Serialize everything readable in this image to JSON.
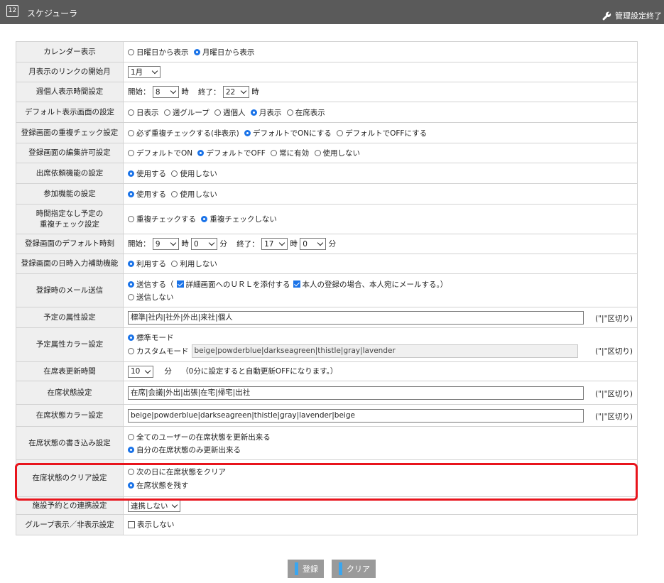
{
  "header": {
    "calendar_icon_number": "12",
    "title": "スケジューラ",
    "exit_label": "管理設定終了"
  },
  "rows": {
    "calendar": {
      "label": "カレンダー表示",
      "opt1": "日曜日から表示",
      "opt2": "月曜日から表示"
    },
    "month_link": {
      "label": "月表示のリンクの開始月",
      "value": "1月"
    },
    "week_personal_time": {
      "label": "週個人表示時間設定",
      "start_label": "開始：",
      "start_value": "8",
      "hour1": "時",
      "end_label": "終了：",
      "end_value": "22",
      "hour2": "時"
    },
    "default_screen": {
      "label": "デフォルト表示画面の設定",
      "opts": [
        "日表示",
        "週グループ",
        "週個人",
        "月表示",
        "在席表示"
      ]
    },
    "dup_check": {
      "label": "登録画面の重複チェック設定",
      "opts": [
        "必ず重複チェックする(非表示)",
        "デフォルトでONにする",
        "デフォルトでOFFにする"
      ]
    },
    "edit_permission": {
      "label": "登録画面の編集許可設定",
      "opts": [
        "デフォルトでON",
        "デフォルトでOFF",
        "常に有効",
        "使用しない"
      ]
    },
    "attendance_request": {
      "label": "出席依頼機能の設定",
      "opts": [
        "使用する",
        "使用しない"
      ]
    },
    "participation": {
      "label": "参加機能の設定",
      "opts": [
        "使用する",
        "使用しない"
      ]
    },
    "no_time_dup": {
      "label_line1": "時間指定なし予定の",
      "label_line2": "重複チェック設定",
      "opts": [
        "重複チェックする",
        "重複チェックしない"
      ]
    },
    "default_time": {
      "label": "登録画面のデフォルト時刻",
      "start_label": "開始：",
      "start_hour": "9",
      "hour1": "時",
      "start_min": "0",
      "min1": "分",
      "end_label": "終了：",
      "end_hour": "17",
      "hour2": "時",
      "end_min": "0",
      "min2": "分"
    },
    "datetime_assist": {
      "label": "登録画面の日時入力補助機能",
      "opts": [
        "利用する",
        "利用しない"
      ]
    },
    "mail": {
      "label": "登録時のメール送信",
      "send": "送信する（",
      "attach_url": "詳細画面へのＵＲＬを添付する",
      "self_mail": "本人の登録の場合、本人宛にメールする。）",
      "no_send": "送信しない"
    },
    "attributes": {
      "label": "予定の属性設定",
      "value": "標準|社内|社外|外出|来社|個人",
      "hint": "(\"|\"区切り)"
    },
    "attr_color": {
      "label": "予定属性カラー設定",
      "opt_standard": "標準モード",
      "opt_custom": "カスタムモード",
      "value": "beige|powderblue|darkseagreen|thistle|gray|lavender",
      "hint": "(\"|\"区切り)"
    },
    "presence_refresh": {
      "label": "在席表更新時間",
      "value": "10",
      "unit": "分",
      "note": "（0分に設定すると自動更新OFFになります。）"
    },
    "presence_status": {
      "label": "在席状態設定",
      "value": "在席|会議|外出|出張|在宅|帰宅|出社",
      "hint": "(\"|\"区切り)"
    },
    "presence_color": {
      "label": "在席状態カラー設定",
      "value": "beige|powderblue|darkseagreen|thistle|gray|lavender|beige",
      "hint": "(\"|\"区切り)"
    },
    "presence_write": {
      "label": "在席状態の書き込み設定",
      "opt1": "全てのユーザーの在席状態を更新出来る",
      "opt2": "自分の在席状態のみ更新出来る"
    },
    "presence_clear": {
      "label": "在席状態のクリア設定",
      "opt1": "次の日に在席状態をクリア",
      "opt2": "在席状態を残す"
    },
    "facility": {
      "label": "施設予約との連携設定",
      "value": "連携しない"
    },
    "group_display": {
      "label": "グループ表示／非表示設定",
      "opt": "表示しない"
    }
  },
  "buttons": {
    "register": "登録",
    "clear": "クリア"
  },
  "colors": {
    "header_bg": "#5a5a5a",
    "label_bg": "#efefef",
    "accent_blue": "#1a73e8",
    "highlight_red": "#e8141c",
    "button_bg": "#9a9a9a",
    "button_bar": "#3aa6f0"
  }
}
